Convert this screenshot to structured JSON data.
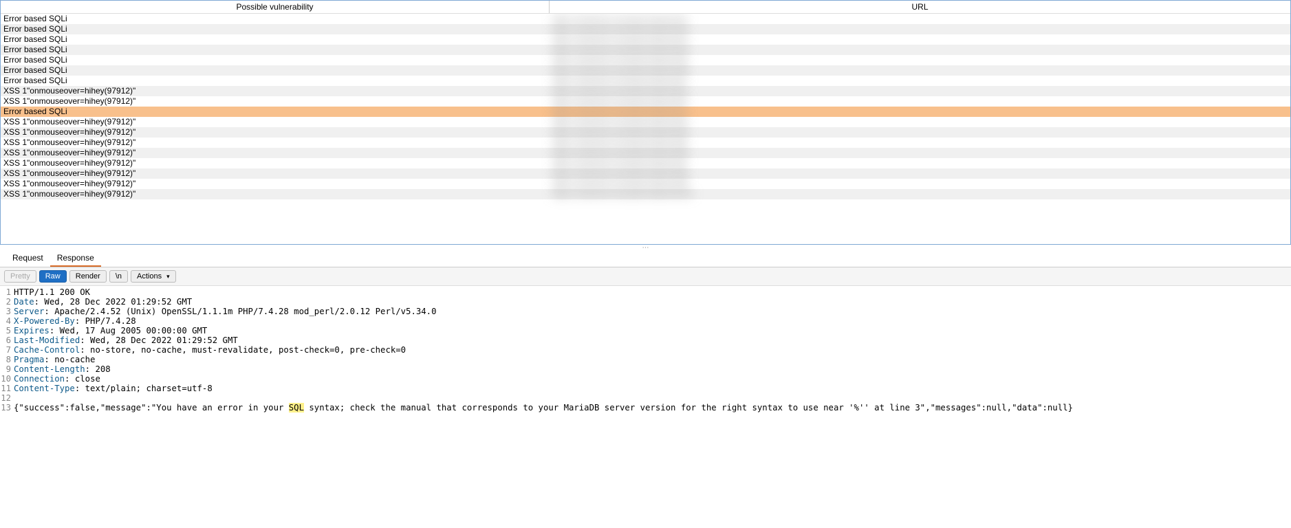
{
  "table": {
    "headers": {
      "vuln": "Possible vulnerability",
      "url": "URL"
    },
    "rows": [
      {
        "vuln": "Error based SQLi",
        "url": "https://redacted.example/endpoint/a1",
        "selected": false
      },
      {
        "vuln": "Error based SQLi",
        "url": "https://redacted.example/endpoint/a2",
        "selected": false
      },
      {
        "vuln": "Error based SQLi",
        "url": "https://redacted.example/endpoint/a3",
        "selected": false
      },
      {
        "vuln": "Error based SQLi",
        "url": "https://redacted.example/endpoint/a4",
        "selected": false
      },
      {
        "vuln": "Error based SQLi",
        "url": "https://redacted.example/endpoint/a5",
        "selected": false
      },
      {
        "vuln": "Error based SQLi",
        "url": "https://redacted.example/endpoint/a6",
        "selected": false
      },
      {
        "vuln": "Error based SQLi",
        "url": "https://redacted.example/endpoint/a7",
        "selected": false
      },
      {
        "vuln": "XSS 1\"onmouseover=hihey(97912)\"",
        "url": "https://redacted.example/endpoint/b1",
        "selected": false
      },
      {
        "vuln": "XSS 1\"onmouseover=hihey(97912)\"",
        "url": "https://redacted.example/endpoint/b2",
        "selected": false
      },
      {
        "vuln": "Error based SQLi",
        "url": "https://redacted.example/endpoint/c1",
        "selected": true
      },
      {
        "vuln": "XSS 1\"onmouseover=hihey(97912)\"",
        "url": "https://redacted.example/endpoint/b3",
        "selected": false
      },
      {
        "vuln": "XSS 1\"onmouseover=hihey(97912)\"",
        "url": "https://redacted.example/endpoint/b4",
        "selected": false
      },
      {
        "vuln": "XSS 1\"onmouseover=hihey(97912)\"",
        "url": "https://redacted.example/endpoint/b5",
        "selected": false
      },
      {
        "vuln": "XSS 1\"onmouseover=hihey(97912)\"",
        "url": "https://redacted.example/endpoint/b6",
        "selected": false
      },
      {
        "vuln": "XSS 1\"onmouseover=hihey(97912)\"",
        "url": "https://redacted.example/endpoint/b7",
        "selected": false
      },
      {
        "vuln": "XSS 1\"onmouseover=hihey(97912)\"",
        "url": "https://redacted.example/endpoint/b8",
        "selected": false
      },
      {
        "vuln": "XSS 1\"onmouseover=hihey(97912)\"",
        "url": "https://redacted.example/endpoint/b9",
        "selected": false
      },
      {
        "vuln": "XSS 1\"onmouseover=hihey(97912)\"",
        "url": "https://redacted.example/endpoint/b10",
        "selected": false
      }
    ]
  },
  "tabs": {
    "request": "Request",
    "response": "Response",
    "active": "response"
  },
  "toolbar": {
    "pretty": "Pretty",
    "raw": "Raw",
    "render": "Render",
    "newline": "\\n",
    "actions": "Actions"
  },
  "response": {
    "lines": [
      {
        "n": 1,
        "header": "",
        "value": "HTTP/1.1 200 OK"
      },
      {
        "n": 2,
        "header": "Date",
        "value": ": Wed, 28 Dec 2022 01:29:52 GMT"
      },
      {
        "n": 3,
        "header": "Server",
        "value": ": Apache/2.4.52 (Unix) OpenSSL/1.1.1m PHP/7.4.28 mod_perl/2.0.12 Perl/v5.34.0"
      },
      {
        "n": 4,
        "header": "X-Powered-By",
        "value": ": PHP/7.4.28"
      },
      {
        "n": 5,
        "header": "Expires",
        "value": ": Wed, 17 Aug 2005 00:00:00 GMT"
      },
      {
        "n": 6,
        "header": "Last-Modified",
        "value": ": Wed, 28 Dec 2022 01:29:52 GMT"
      },
      {
        "n": 7,
        "header": "Cache-Control",
        "value": ": no-store, no-cache, must-revalidate, post-check=0, pre-check=0"
      },
      {
        "n": 8,
        "header": "Pragma",
        "value": ": no-cache"
      },
      {
        "n": 9,
        "header": "Content-Length",
        "value": ": 208"
      },
      {
        "n": 10,
        "header": "Connection",
        "value": ": close"
      },
      {
        "n": 11,
        "header": "Content-Type",
        "value": ": text/plain; charset=utf-8"
      },
      {
        "n": 12,
        "header": "",
        "value": ""
      },
      {
        "n": 13,
        "header": "",
        "value_pre": "{\"success\":false,\"message\":\"You have an error in your ",
        "highlight": "SQL",
        "value_post": " syntax; check the manual that corresponds to your MariaDB server version for the right syntax to use near '%'' at line 3\",\"messages\":null,\"data\":null}"
      }
    ]
  }
}
